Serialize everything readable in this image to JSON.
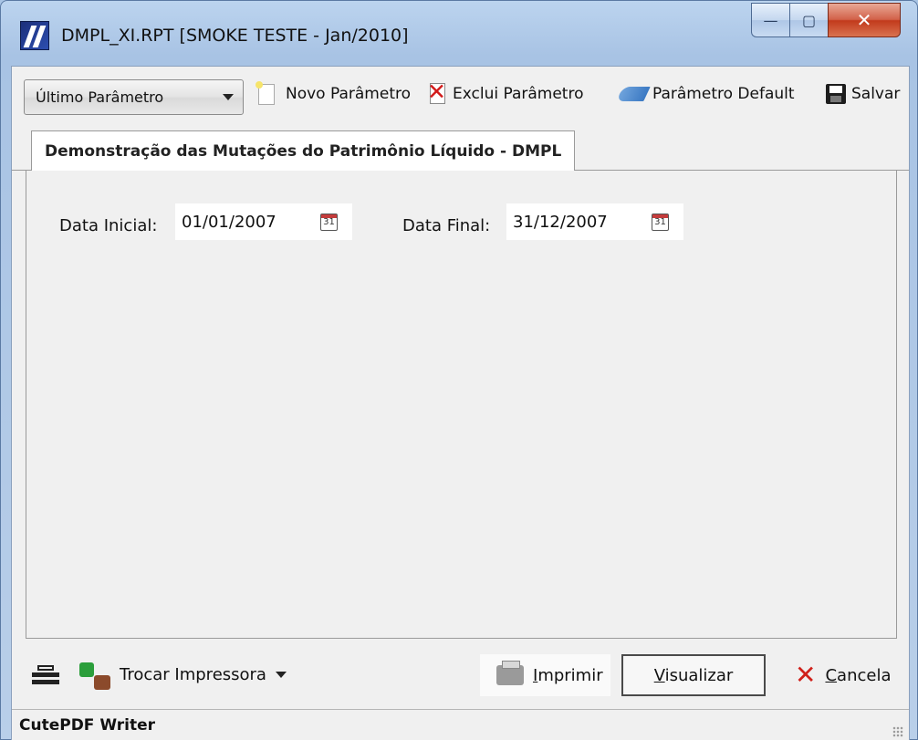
{
  "window": {
    "title": "DMPL_XI.RPT [SMOKE TESTE - Jan/2010]",
    "controls": {
      "minimize": "—",
      "maximize": "▢",
      "close": "✕"
    }
  },
  "toolbar": {
    "parameter_combo_value": "Último Parâmetro",
    "new_label": "Novo Parâmetro",
    "delete_label": "Exclui Parâmetro",
    "default_label": "Parâmetro Default",
    "save_label": "Salvar"
  },
  "tabs": [
    {
      "label": "Demonstração das Mutações do Patrimônio Líquido - DMPL",
      "active": true
    }
  ],
  "form": {
    "start_label": "Data Inicial:",
    "start_value": "01/01/2007",
    "end_label": "Data Final:",
    "end_value": "31/12/2007"
  },
  "bottom": {
    "change_printer_label": "Trocar Impressora",
    "print_label_first": "I",
    "print_label_rest": "mprimir",
    "preview_label_first": "V",
    "preview_label_rest": "isualizar",
    "cancel_label_first": "C",
    "cancel_label_rest": "ancela"
  },
  "status": {
    "printer_name": "CutePDF Writer"
  },
  "icons": {
    "calendar": "calendar-icon",
    "calendar_glyph": "31"
  }
}
